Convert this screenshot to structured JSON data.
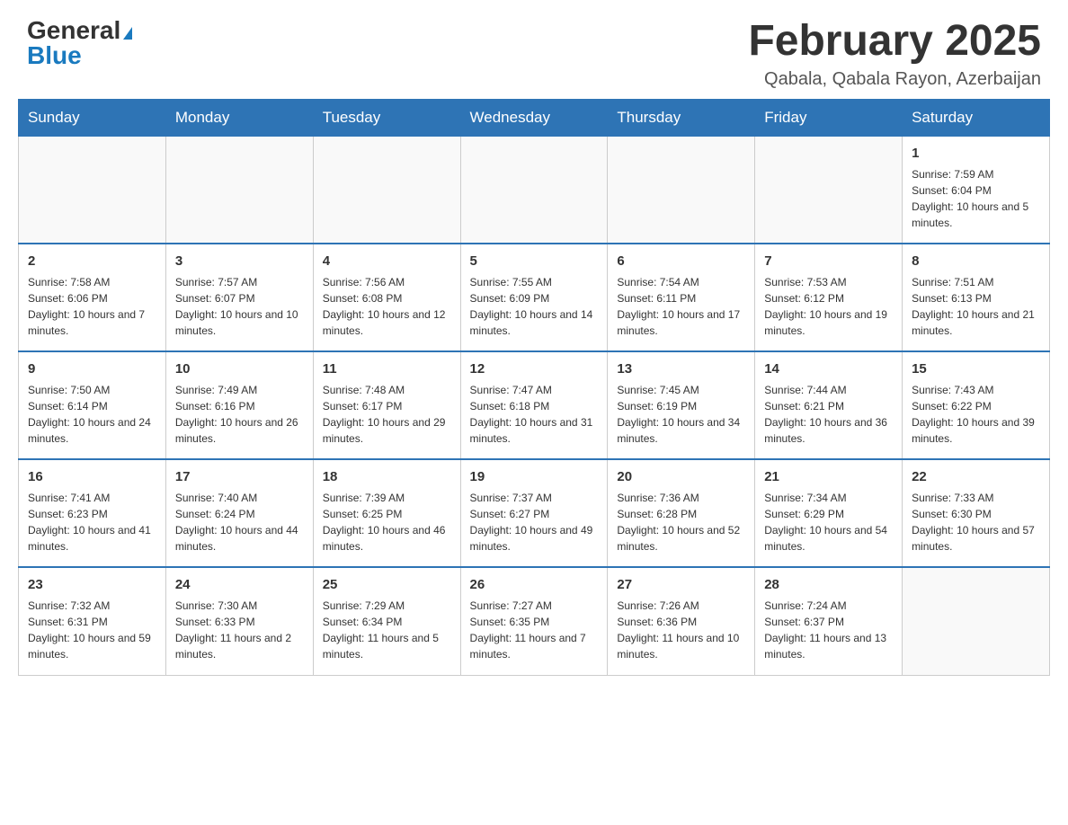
{
  "header": {
    "logo_general": "General",
    "logo_blue": "Blue",
    "month_title": "February 2025",
    "location": "Qabala, Qabala Rayon, Azerbaijan"
  },
  "weekdays": [
    "Sunday",
    "Monday",
    "Tuesday",
    "Wednesday",
    "Thursday",
    "Friday",
    "Saturday"
  ],
  "weeks": [
    [
      {
        "day": "",
        "info": ""
      },
      {
        "day": "",
        "info": ""
      },
      {
        "day": "",
        "info": ""
      },
      {
        "day": "",
        "info": ""
      },
      {
        "day": "",
        "info": ""
      },
      {
        "day": "",
        "info": ""
      },
      {
        "day": "1",
        "info": "Sunrise: 7:59 AM\nSunset: 6:04 PM\nDaylight: 10 hours and 5 minutes."
      }
    ],
    [
      {
        "day": "2",
        "info": "Sunrise: 7:58 AM\nSunset: 6:06 PM\nDaylight: 10 hours and 7 minutes."
      },
      {
        "day": "3",
        "info": "Sunrise: 7:57 AM\nSunset: 6:07 PM\nDaylight: 10 hours and 10 minutes."
      },
      {
        "day": "4",
        "info": "Sunrise: 7:56 AM\nSunset: 6:08 PM\nDaylight: 10 hours and 12 minutes."
      },
      {
        "day": "5",
        "info": "Sunrise: 7:55 AM\nSunset: 6:09 PM\nDaylight: 10 hours and 14 minutes."
      },
      {
        "day": "6",
        "info": "Sunrise: 7:54 AM\nSunset: 6:11 PM\nDaylight: 10 hours and 17 minutes."
      },
      {
        "day": "7",
        "info": "Sunrise: 7:53 AM\nSunset: 6:12 PM\nDaylight: 10 hours and 19 minutes."
      },
      {
        "day": "8",
        "info": "Sunrise: 7:51 AM\nSunset: 6:13 PM\nDaylight: 10 hours and 21 minutes."
      }
    ],
    [
      {
        "day": "9",
        "info": "Sunrise: 7:50 AM\nSunset: 6:14 PM\nDaylight: 10 hours and 24 minutes."
      },
      {
        "day": "10",
        "info": "Sunrise: 7:49 AM\nSunset: 6:16 PM\nDaylight: 10 hours and 26 minutes."
      },
      {
        "day": "11",
        "info": "Sunrise: 7:48 AM\nSunset: 6:17 PM\nDaylight: 10 hours and 29 minutes."
      },
      {
        "day": "12",
        "info": "Sunrise: 7:47 AM\nSunset: 6:18 PM\nDaylight: 10 hours and 31 minutes."
      },
      {
        "day": "13",
        "info": "Sunrise: 7:45 AM\nSunset: 6:19 PM\nDaylight: 10 hours and 34 minutes."
      },
      {
        "day": "14",
        "info": "Sunrise: 7:44 AM\nSunset: 6:21 PM\nDaylight: 10 hours and 36 minutes."
      },
      {
        "day": "15",
        "info": "Sunrise: 7:43 AM\nSunset: 6:22 PM\nDaylight: 10 hours and 39 minutes."
      }
    ],
    [
      {
        "day": "16",
        "info": "Sunrise: 7:41 AM\nSunset: 6:23 PM\nDaylight: 10 hours and 41 minutes."
      },
      {
        "day": "17",
        "info": "Sunrise: 7:40 AM\nSunset: 6:24 PM\nDaylight: 10 hours and 44 minutes."
      },
      {
        "day": "18",
        "info": "Sunrise: 7:39 AM\nSunset: 6:25 PM\nDaylight: 10 hours and 46 minutes."
      },
      {
        "day": "19",
        "info": "Sunrise: 7:37 AM\nSunset: 6:27 PM\nDaylight: 10 hours and 49 minutes."
      },
      {
        "day": "20",
        "info": "Sunrise: 7:36 AM\nSunset: 6:28 PM\nDaylight: 10 hours and 52 minutes."
      },
      {
        "day": "21",
        "info": "Sunrise: 7:34 AM\nSunset: 6:29 PM\nDaylight: 10 hours and 54 minutes."
      },
      {
        "day": "22",
        "info": "Sunrise: 7:33 AM\nSunset: 6:30 PM\nDaylight: 10 hours and 57 minutes."
      }
    ],
    [
      {
        "day": "23",
        "info": "Sunrise: 7:32 AM\nSunset: 6:31 PM\nDaylight: 10 hours and 59 minutes."
      },
      {
        "day": "24",
        "info": "Sunrise: 7:30 AM\nSunset: 6:33 PM\nDaylight: 11 hours and 2 minutes."
      },
      {
        "day": "25",
        "info": "Sunrise: 7:29 AM\nSunset: 6:34 PM\nDaylight: 11 hours and 5 minutes."
      },
      {
        "day": "26",
        "info": "Sunrise: 7:27 AM\nSunset: 6:35 PM\nDaylight: 11 hours and 7 minutes."
      },
      {
        "day": "27",
        "info": "Sunrise: 7:26 AM\nSunset: 6:36 PM\nDaylight: 11 hours and 10 minutes."
      },
      {
        "day": "28",
        "info": "Sunrise: 7:24 AM\nSunset: 6:37 PM\nDaylight: 11 hours and 13 minutes."
      },
      {
        "day": "",
        "info": ""
      }
    ]
  ]
}
